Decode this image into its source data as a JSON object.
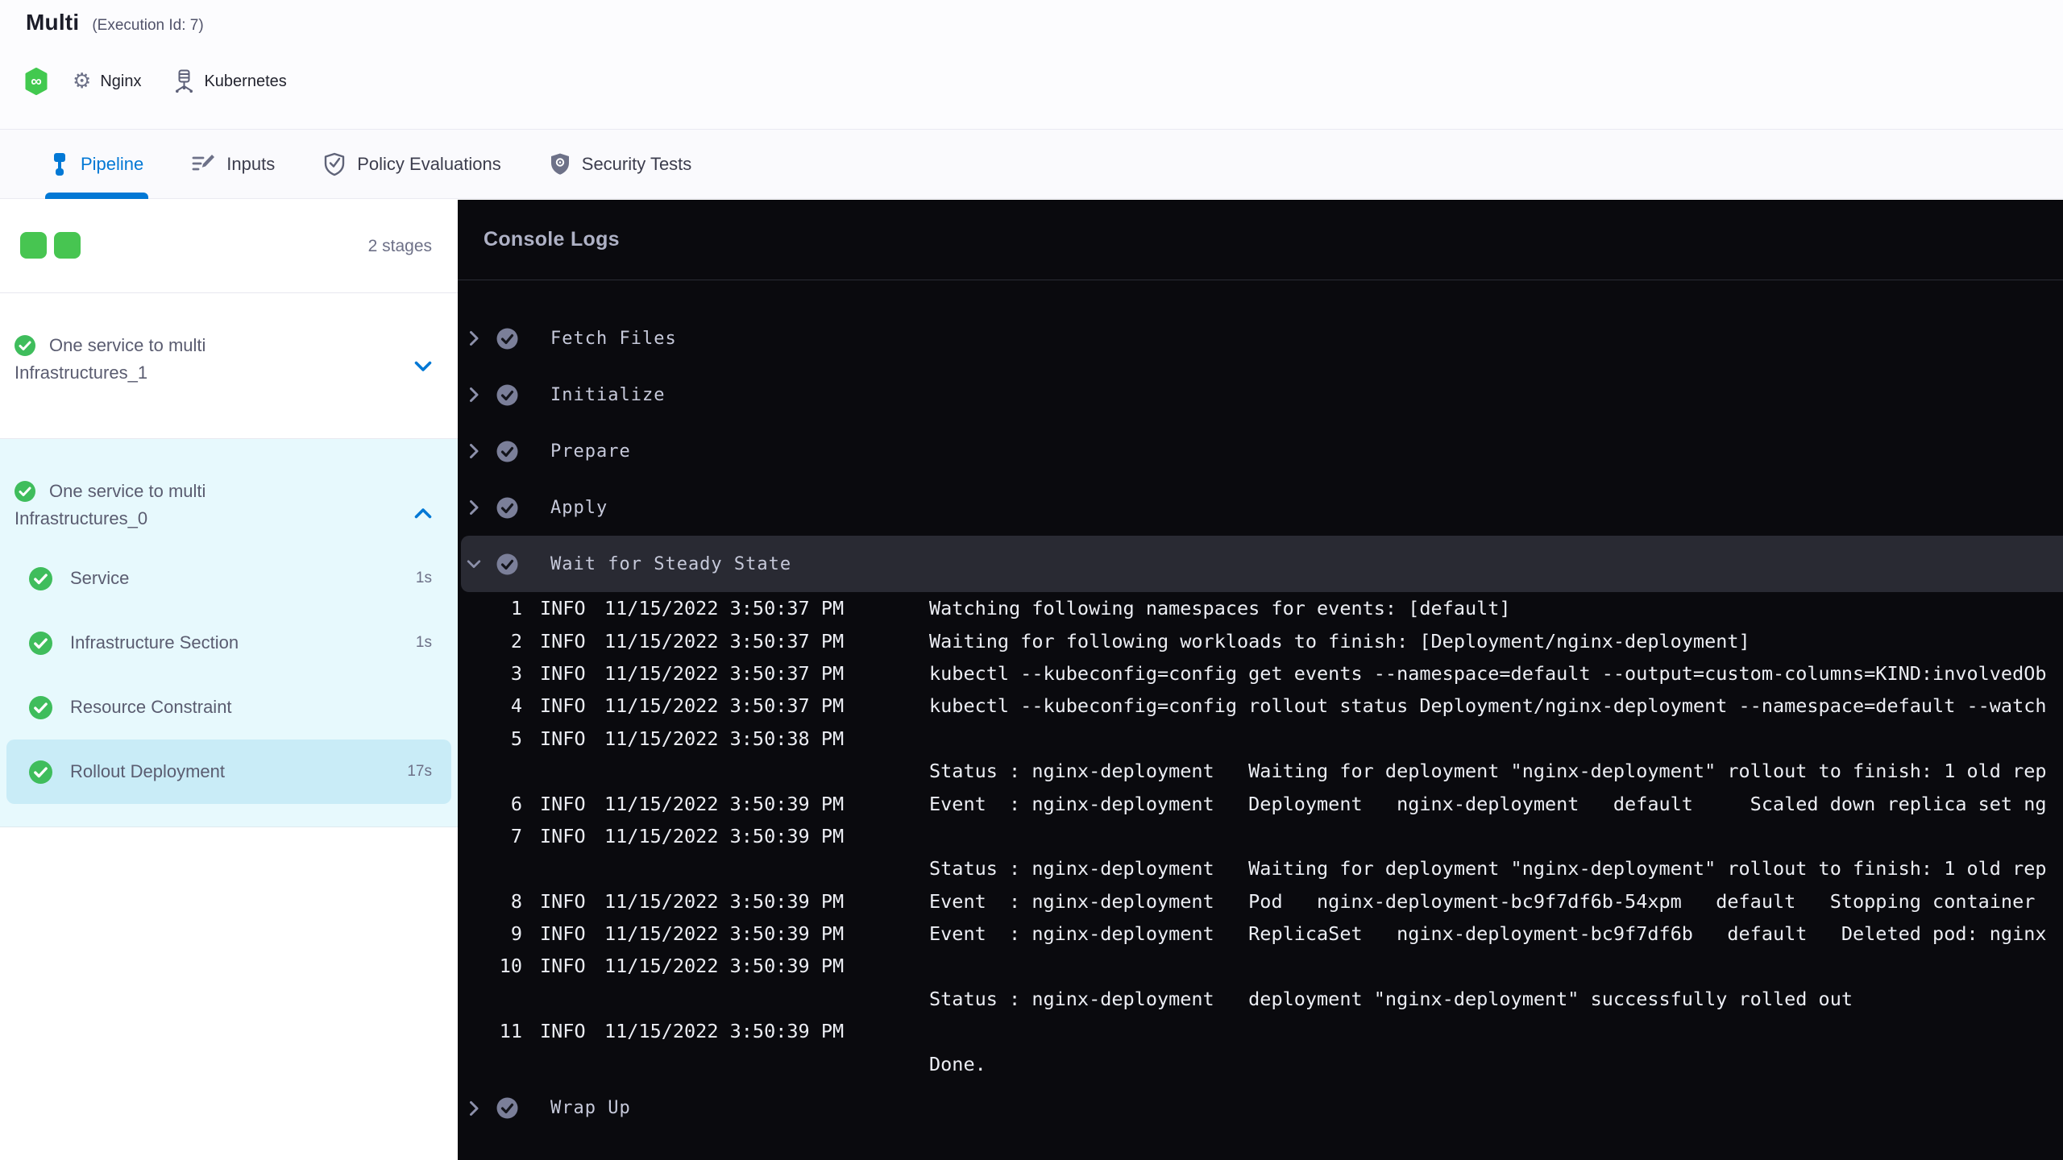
{
  "colors": {
    "accent_blue": "#0278d5",
    "success_green": "#42ba57",
    "selected_step_bg": "#c9ecf7",
    "console_bg": "#0a0a0e"
  },
  "header": {
    "title": "Multi",
    "execution_id": "(Execution Id: 7)",
    "service_label": "Nginx",
    "infrastructure_label": "Kubernetes"
  },
  "tabs": [
    {
      "label": "Pipeline",
      "active": true
    },
    {
      "label": "Inputs",
      "active": false
    },
    {
      "label": "Policy Evaluations",
      "active": false
    },
    {
      "label": "Security Tests",
      "active": false
    }
  ],
  "sidebar": {
    "stage_count": "2 stages",
    "groups": [
      {
        "label_line1": "One service to multi",
        "label_line2": "Infrastructures_1",
        "status": "success",
        "expanded": false
      },
      {
        "label_line1": "One service to multi",
        "label_line2": "Infrastructures_0",
        "status": "success",
        "expanded": true,
        "steps": [
          {
            "label": "Service",
            "duration": "1s",
            "selected": false
          },
          {
            "label": "Infrastructure Section",
            "duration": "1s",
            "selected": false
          },
          {
            "label": "Resource Constraint",
            "duration": "",
            "selected": false
          },
          {
            "label": "Rollout Deployment",
            "duration": "17s",
            "selected": true
          }
        ]
      }
    ]
  },
  "console": {
    "title": "Console Logs",
    "steps_before": [
      "Fetch Files",
      "Initialize",
      "Prepare",
      "Apply"
    ],
    "expanded_step": "Wait for Steady State",
    "steps_after": [
      "Wrap Up"
    ],
    "logs": [
      {
        "num": "1",
        "level": "INFO",
        "time": "11/15/2022 3:50:37 PM",
        "msg": "Watching following namespaces for events: [default]"
      },
      {
        "num": "2",
        "level": "INFO",
        "time": "11/15/2022 3:50:37 PM",
        "msg": "Waiting for following workloads to finish: [Deployment/nginx-deployment]"
      },
      {
        "num": "3",
        "level": "INFO",
        "time": "11/15/2022 3:50:37 PM",
        "msg": "kubectl --kubeconfig=config get events --namespace=default --output=custom-columns=KIND:involvedOb"
      },
      {
        "num": "4",
        "level": "INFO",
        "time": "11/15/2022 3:50:37 PM",
        "msg": "kubectl --kubeconfig=config rollout status Deployment/nginx-deployment --namespace=default --watch"
      },
      {
        "num": "5",
        "level": "INFO",
        "time": "11/15/2022 3:50:38 PM",
        "msg": ""
      },
      {
        "num": "",
        "level": "",
        "time": "",
        "msg": "Status : nginx-deployment   Waiting for deployment \"nginx-deployment\" rollout to finish: 1 old rep"
      },
      {
        "num": "6",
        "level": "INFO",
        "time": "11/15/2022 3:50:39 PM",
        "msg": "Event  : nginx-deployment   Deployment   nginx-deployment   default     Scaled down replica set ng"
      },
      {
        "num": "7",
        "level": "INFO",
        "time": "11/15/2022 3:50:39 PM",
        "msg": ""
      },
      {
        "num": "",
        "level": "",
        "time": "",
        "msg": "Status : nginx-deployment   Waiting for deployment \"nginx-deployment\" rollout to finish: 1 old rep"
      },
      {
        "num": "8",
        "level": "INFO",
        "time": "11/15/2022 3:50:39 PM",
        "msg": "Event  : nginx-deployment   Pod   nginx-deployment-bc9f7df6b-54xpm   default   Stopping container"
      },
      {
        "num": "9",
        "level": "INFO",
        "time": "11/15/2022 3:50:39 PM",
        "msg": "Event  : nginx-deployment   ReplicaSet   nginx-deployment-bc9f7df6b   default   Deleted pod: nginx"
      },
      {
        "num": "10",
        "level": "INFO",
        "time": "11/15/2022 3:50:39 PM",
        "msg": ""
      },
      {
        "num": "",
        "level": "",
        "time": "",
        "msg": "Status : nginx-deployment   deployment \"nginx-deployment\" successfully rolled out"
      },
      {
        "num": "11",
        "level": "INFO",
        "time": "11/15/2022 3:50:39 PM",
        "msg": ""
      },
      {
        "num": "",
        "level": "",
        "time": "",
        "msg": "Done."
      }
    ]
  }
}
